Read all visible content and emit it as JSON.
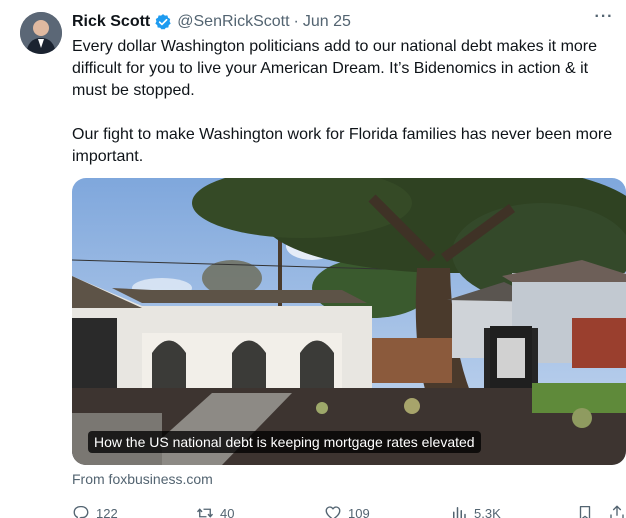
{
  "author": {
    "name": "Rick Scott",
    "handle": "@SenRickScott",
    "separator": "·",
    "date": "Jun 25"
  },
  "more_label": "···",
  "tweet_paragraphs": [
    "Every dollar Washington politicians add to our national debt makes it more difficult for you to live your American Dream. It’s Bidenomics in action & it must be stopped.",
    "Our fight to make Washington work for Florida families has never been more important."
  ],
  "card": {
    "headline": "How the US national debt is keeping mortgage rates elevated",
    "source": "From foxbusiness.com"
  },
  "actions": {
    "replies": "122",
    "reposts": "40",
    "likes": "109",
    "views": "5.3K"
  },
  "colors": {
    "text": "#0f1419",
    "muted": "#536471",
    "verified": "#1d9bf0"
  }
}
